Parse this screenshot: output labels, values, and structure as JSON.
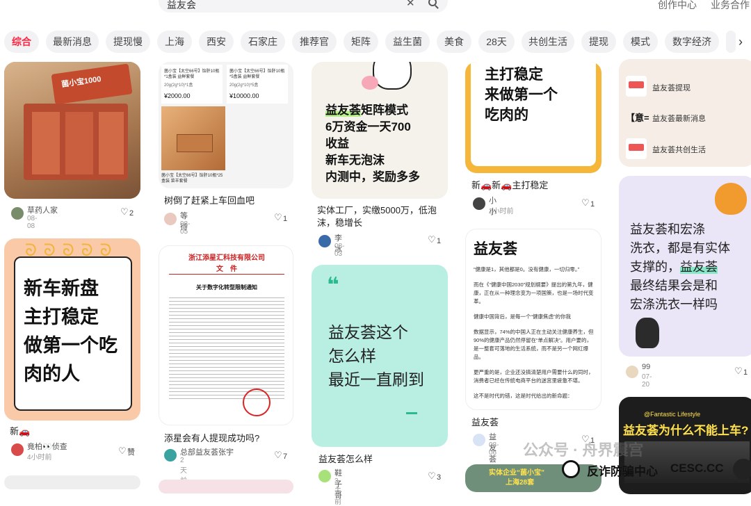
{
  "search": {
    "query": "益友会"
  },
  "toplinks": [
    "创作中心",
    "业务合作"
  ],
  "tabs": [
    "综合",
    "最新消息",
    "提现慢",
    "上海",
    "西安",
    "石家庄",
    "推荐官",
    "矩阵",
    "益生菌",
    "美食",
    "28天",
    "共创生活",
    "提现",
    "模式",
    "数字经济"
  ],
  "colors": {
    "accent": "#ff2442",
    "tab_bg": "#f2f2f4"
  },
  "cards": {
    "c1": {
      "box_text": "菌小宝1000",
      "title": "",
      "user": "草药人家",
      "date": "08-08",
      "likes": "2"
    },
    "c2": {
      "p1_title": "菌小宝【太空66号】饴肝10瓶*1盒装 益鲜套餐",
      "p1_spec": "20g(2g*10)*1盒",
      "p1_price": "¥2000.00",
      "p2_title": "菌小宝【太空66号】饴肝10瓶*5盒装 益鲜套餐",
      "p2_spec": "20g(2g*10)*5盒",
      "p2_price": "¥10000.00",
      "p3_title": "菌小宝【太空66号】饴肝10瓶*25盒装 菜羊套餐",
      "title": "树倒了赶紧上车回血吧",
      "user": "等待",
      "date": "08-05",
      "likes": "1"
    },
    "c3": {
      "line1_hl": "益友荟",
      "line1_rest": "矩阵模式",
      "line2": "6万资金一天700",
      "line3": "收益",
      "line4": "新车无泡沫",
      "line5": "内测中，奖励多多",
      "title": "实体工厂，实缴5000万，低泡沫，稳增长",
      "user": "李冰",
      "date": "08-03",
      "likes": "1"
    },
    "c4": {
      "line1": "主打稳定",
      "line2": "来做第一个",
      "line3": "吃肉的",
      "title": "新🚗新🚗主打稳定",
      "user": "小小",
      "date": "2小时前",
      "likes": "1"
    },
    "c5": {
      "items": [
        "益友荟提现",
        "益友荟最新消息",
        "益友荟共创生活"
      ],
      "tag": "【意="
    },
    "c6": {
      "line1": "益友荟和宏涤",
      "line2": "洗衣，都是有实体",
      "line3a": "支撑的，",
      "line3b": "益友荟",
      "line4": "最终结果会是和",
      "line5": "宏涤洗衣一样吗",
      "user": "99",
      "date": "07-20",
      "likes": "1"
    },
    "c7": {
      "line1": "新车新盘",
      "line2": "主打稳定",
      "line3": "做第一个吃",
      "line4": "肉的人",
      "title": "新🚗",
      "user": "竟柏👀侦查",
      "date": "4小时前",
      "likes": "赞"
    },
    "c8": {
      "company": "浙江添星汇科技有限公司",
      "doc": "文　件",
      "notice": "关于数字化转型限制通知",
      "title": "添星会有人提现成功吗?",
      "user": "总部益友荟张宇",
      "date": "2天前",
      "likes": "7"
    },
    "c9": {
      "quote": "❝",
      "line1": "益友荟这个",
      "line2": "怎么样",
      "line3": "最近一直刷到",
      "title": "益友荟怎么样",
      "user": "鞋子哥",
      "date": "3天前",
      "likes": "3"
    },
    "c10": {
      "heading": "益友荟",
      "paras": [
        "“健康是1，其他都是0。没有健康，一切归零。”",
        "而在《“健康中国2030”规划纲要》提出的第九年，健康，正在从一种理念变为一项国策，也是一场时代变革。",
        "健康中国背后，是每一个“健康焦虑”的你我",
        "数据显示，74%的中国人正在主动关注健康养生，但90%的健康产品仍然停留在“单点解决”。用户要的，是一整套可落地的生活系统，而不是另一个网红爆品。",
        "更严重的是，企业还没搞清楚用户需要什么的同时，消费者已经在传统电商平台的迷宫里疲惫不堪。",
        "这不是时代的错，这是时代给出的新命题："
      ],
      "title": "益友荟",
      "user": "益友荟",
      "date": "08-06",
      "likes": "1"
    },
    "c11": {
      "tag": "@Fantastic Lifestyle",
      "headline": "益友荟为什么不能上车?"
    },
    "c12": {
      "strip": "实体企业“菌小宝”",
      "strip2": "上海28套"
    }
  },
  "watermark": {
    "gzh": "公众号 · 舟界震宫",
    "fz": "反诈防骗中心",
    "cesc": "CESC.CC"
  }
}
